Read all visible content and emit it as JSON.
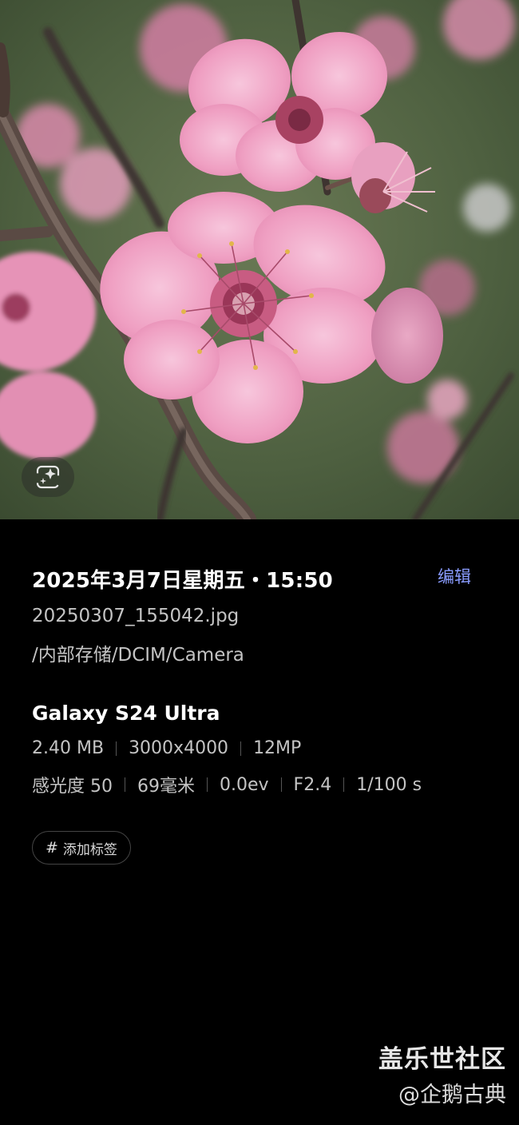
{
  "photo": {
    "subject": "pink plum blossoms on branch",
    "ai_button_icon": "ai-sparkle-edit-icon"
  },
  "details": {
    "datetime": "2025年3月7日星期五・15:50",
    "edit_label": "编辑",
    "filename": "20250307_155042.jpg",
    "path": "/内部存储/DCIM/Camera",
    "device": "Galaxy S24 Ultra",
    "file_size": "2.40 MB",
    "resolution": "3000x4000",
    "megapixels": "12MP",
    "iso": "感光度 50",
    "focal_length": "69毫米",
    "exposure": "0.0ev",
    "aperture": "F2.4",
    "shutter": "1/100 s",
    "tag_button_label": "添加标签",
    "tag_icon": "#"
  },
  "watermark": {
    "line1": "盖乐世社区",
    "line2": "@企鹅古典"
  },
  "colors": {
    "background": "#000000",
    "accent": "#8a9cff",
    "secondary_text": "#c4c4c4"
  }
}
